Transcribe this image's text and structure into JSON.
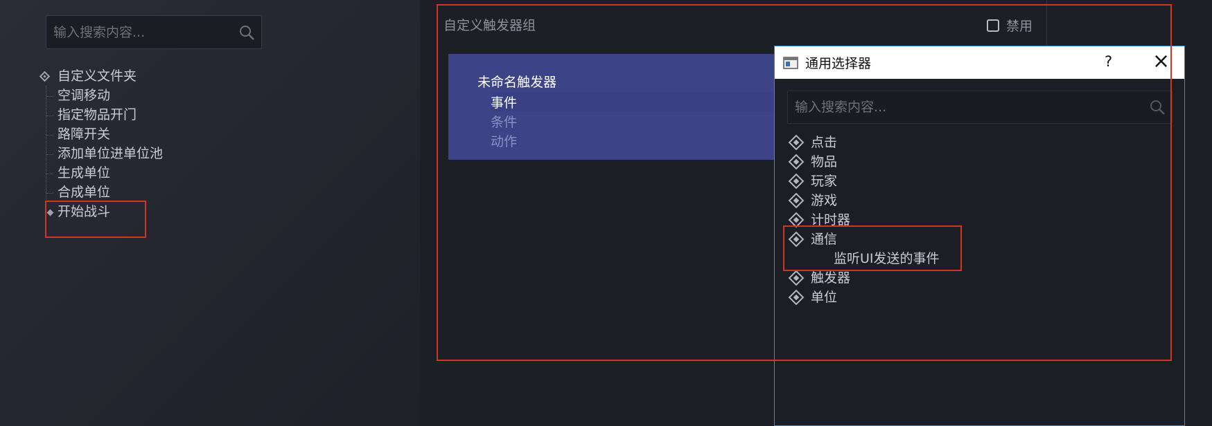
{
  "left_panel": {
    "search_placeholder": "输入搜索内容...",
    "tree": {
      "root_label": "自定义文件夹",
      "children": [
        "空调移动",
        "指定物品开门",
        "路障开关",
        "添加单位进单位池",
        "生成单位",
        "合成单位"
      ],
      "selected_label": "开始战斗"
    }
  },
  "main": {
    "group_title": "自定义触发器组",
    "disable_label": "禁用",
    "disable_checked": false,
    "trigger": {
      "name": "未命名触发器",
      "sections": [
        "事件",
        "条件",
        "动作"
      ]
    }
  },
  "dialog": {
    "title": "通用选择器",
    "help_label": "?",
    "close_label": "×",
    "search_placeholder": "输入搜索内容...",
    "categories": [
      "点击",
      "物品",
      "玩家",
      "游戏",
      "计时器",
      "通信",
      "触发器",
      "单位"
    ],
    "expanded_category": "通信",
    "expanded_item": "监听UI发送的事件"
  },
  "colors": {
    "annotation_red": "#d0371f",
    "dialog_border": "#2d8ee0",
    "trigger_card": "#3c4387"
  }
}
